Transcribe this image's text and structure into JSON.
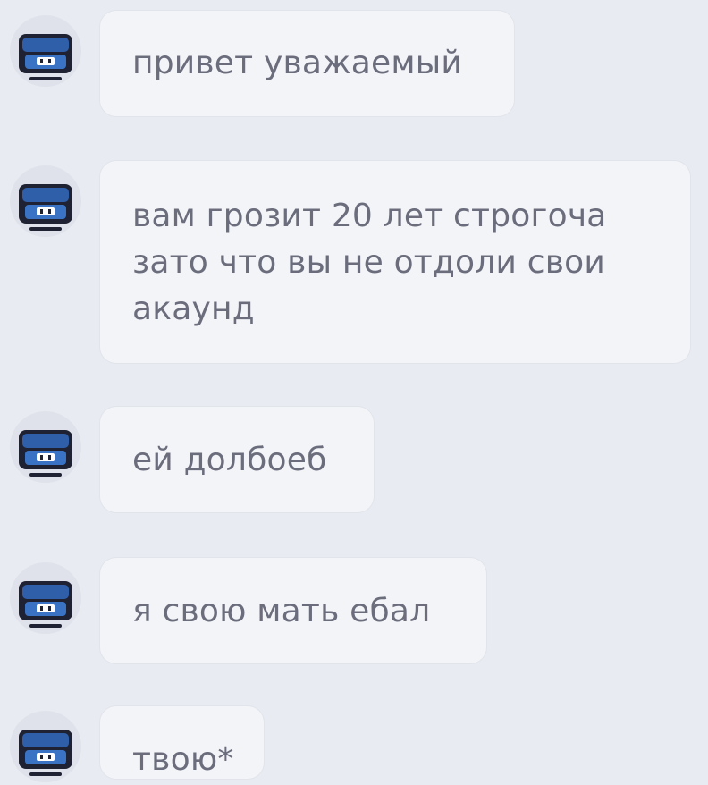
{
  "chat": {
    "messages": [
      {
        "text": "привет уважаемый",
        "avatar_icon": "chest-avatar-icon"
      },
      {
        "text": "вам грозит 20 лет строгоча\nзато что вы не отдоли свои\nакаунд",
        "avatar_icon": "chest-avatar-icon"
      },
      {
        "text": "ей долбоеб",
        "avatar_icon": "chest-avatar-icon"
      },
      {
        "text": "я свою мать ебал",
        "avatar_icon": "chest-avatar-icon"
      },
      {
        "text": "твою*",
        "avatar_icon": "chest-avatar-icon"
      }
    ]
  },
  "colors": {
    "background": "#e9ebf2",
    "bubble": "#f3f4f8",
    "text": "#6b6d7d",
    "avatar_dark": "#1f2233",
    "avatar_blue": "#2f5fa8"
  }
}
